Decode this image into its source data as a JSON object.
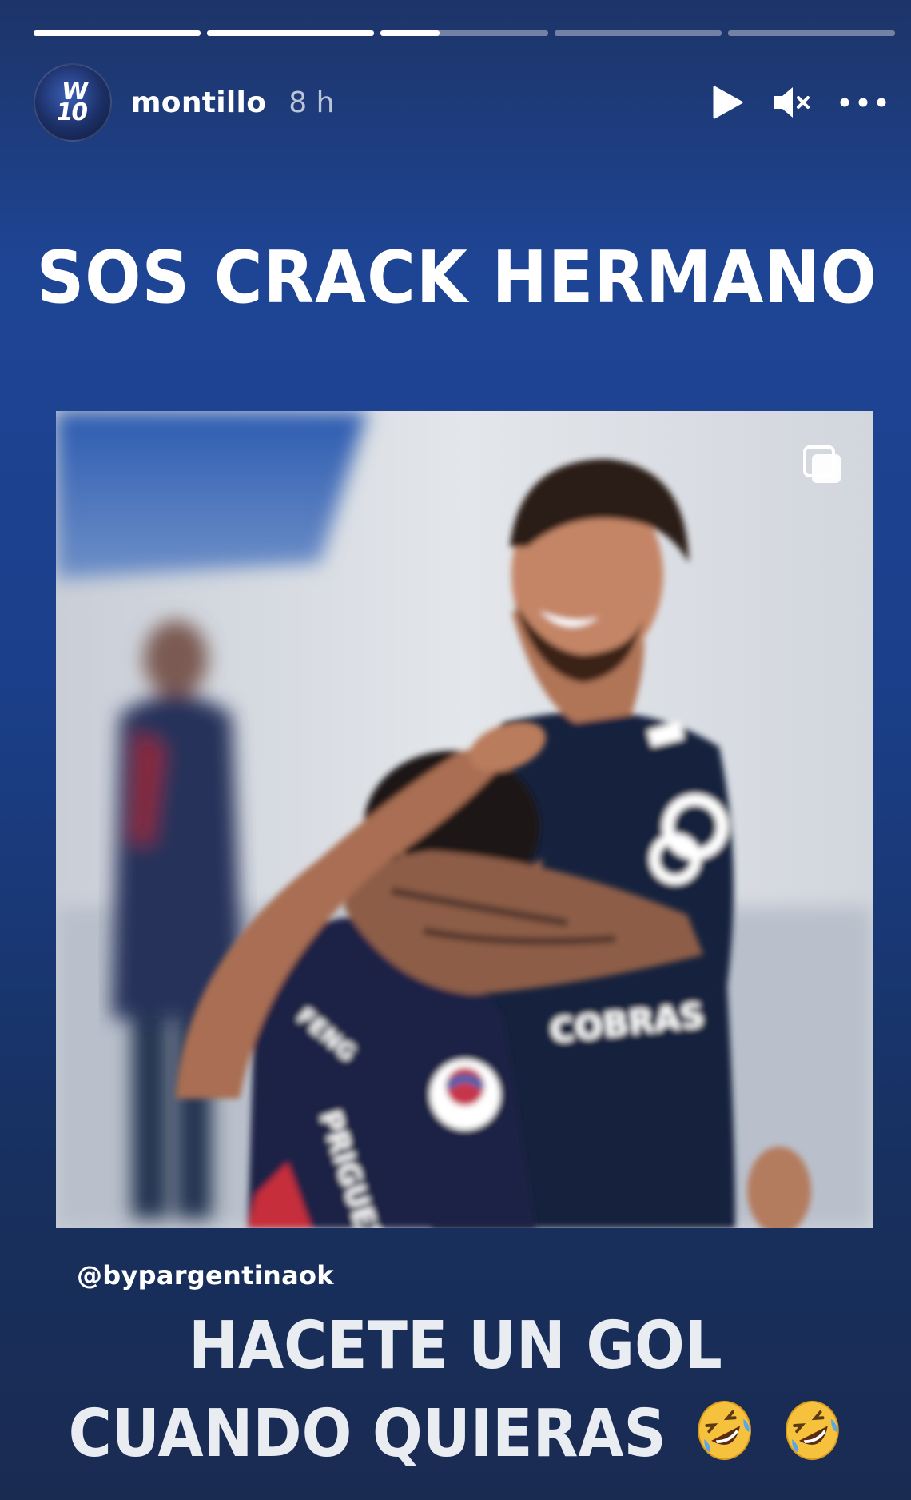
{
  "story": {
    "progress": [
      1.0,
      1.0,
      0.35,
      0.0,
      0.0
    ],
    "author": {
      "username": "montillo",
      "time_ago": "8 h",
      "avatar_icon": "avatar-badge-icon"
    },
    "controls": {
      "play_icon": "play-icon",
      "mute_icon": "mute-icon",
      "more_icon": "more-options-icon"
    },
    "headline": "SOS CRACK HERMANO",
    "shared_post": {
      "icon": "carousel-multiple-icon",
      "mention": "@bypargentinaok"
    },
    "caption_lines": [
      "HACETE UN GOL",
      "CUANDO QUIERAS"
    ],
    "caption_emoji": [
      "rolling-on-floor-laughing-emoji",
      "rolling-on-floor-laughing-emoji"
    ]
  }
}
